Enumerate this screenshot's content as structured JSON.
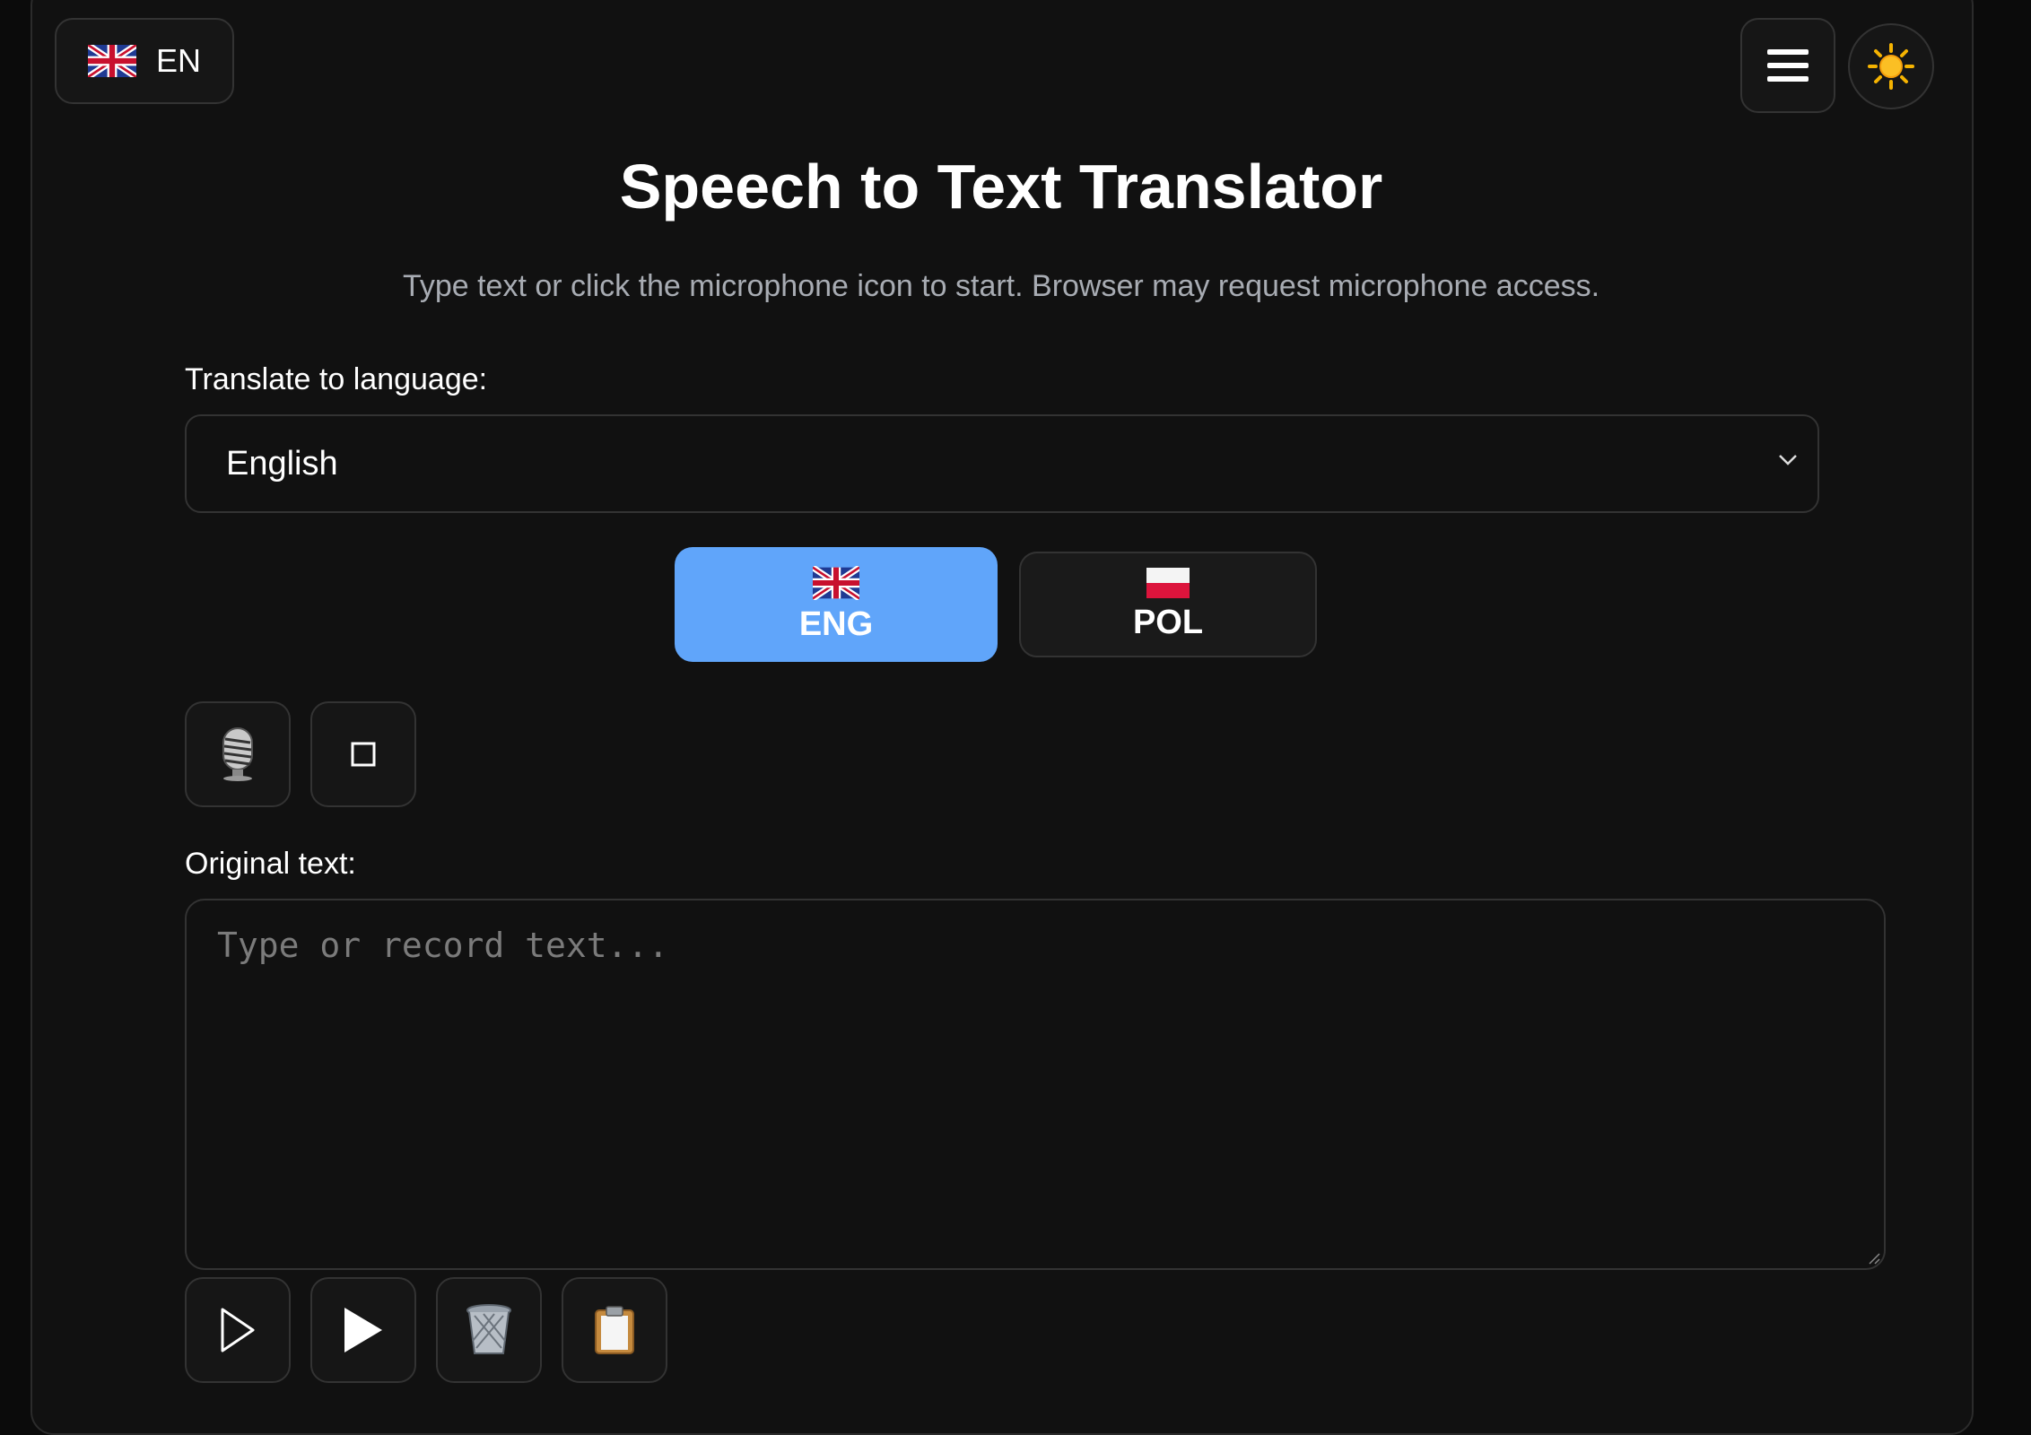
{
  "header": {
    "language_code": "EN",
    "language_flag_icon": "uk-flag-icon",
    "menu_icon": "hamburger-menu-icon",
    "theme_icon": "sun-icon"
  },
  "page": {
    "title": "Speech to Text Translator",
    "subtitle": "Type text or click the microphone icon to start. Browser may request microphone access."
  },
  "translate": {
    "label": "Translate to language:",
    "selected": "English"
  },
  "source_language": {
    "options": [
      {
        "code": "ENG",
        "flag": "uk-flag-icon",
        "active": true
      },
      {
        "code": "POL",
        "flag": "poland-flag-icon",
        "active": false
      }
    ]
  },
  "recording": {
    "mic_icon": "microphone-icon",
    "stop_icon": "stop-square-icon"
  },
  "original": {
    "label": "Original text:",
    "placeholder": "Type or record text..."
  },
  "actions": {
    "icons": [
      "play-outline-icon",
      "play-filled-icon",
      "trash-icon",
      "clipboard-icon"
    ]
  },
  "colors": {
    "accent": "#60a5fa",
    "background": "#111111"
  }
}
